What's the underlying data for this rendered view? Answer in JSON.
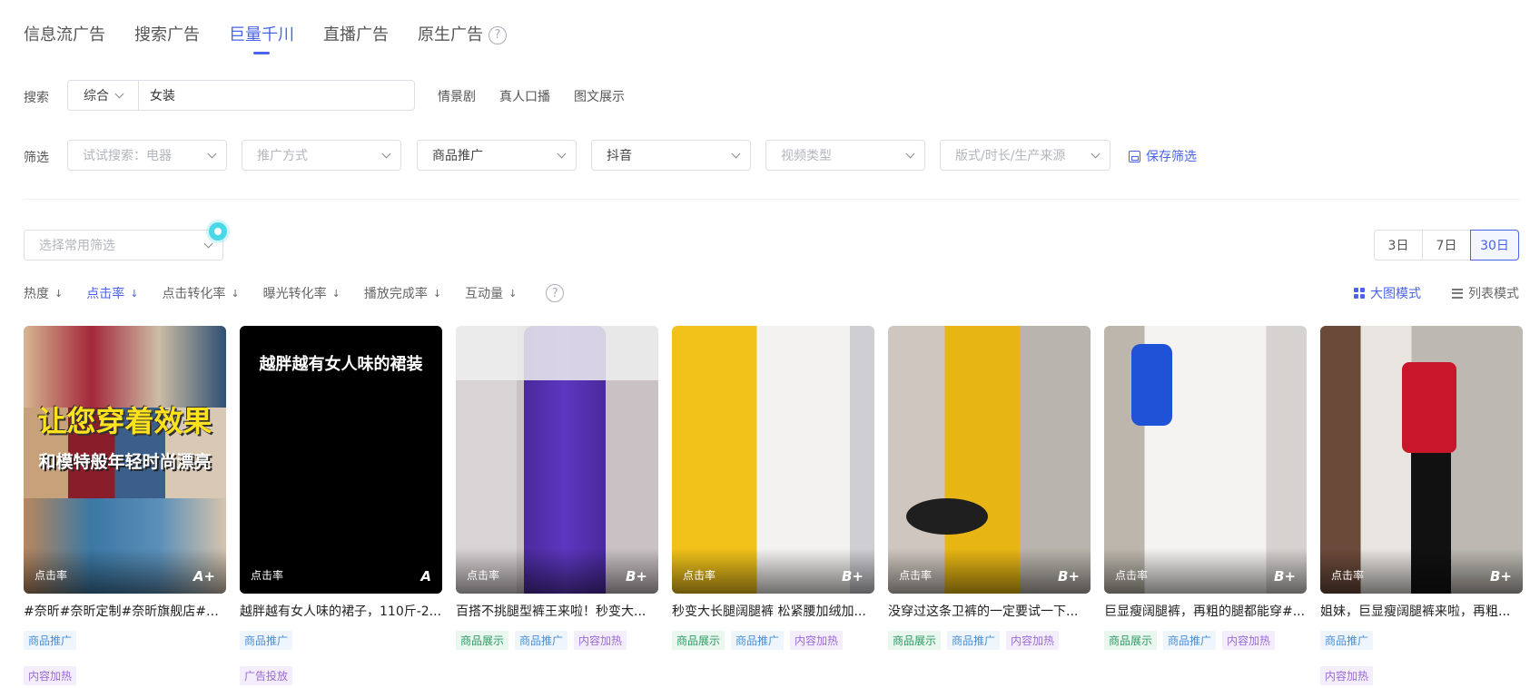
{
  "tabs": [
    {
      "label": "信息流广告",
      "active": false
    },
    {
      "label": "搜索广告",
      "active": false
    },
    {
      "label": "巨量千川",
      "active": true
    },
    {
      "label": "直播广告",
      "active": false
    },
    {
      "label": "原生广告",
      "active": false
    }
  ],
  "tab_help_icon": "question-circle-icon",
  "search": {
    "label": "搜索",
    "type_value": "综合",
    "query": "女装",
    "quick_tags": [
      "情景剧",
      "真人口播",
      "图文展示"
    ]
  },
  "filters": {
    "label": "筛选",
    "items": [
      {
        "placeholder": "试试搜索：电器",
        "value": ""
      },
      {
        "placeholder": "推广方式",
        "value": ""
      },
      {
        "placeholder": "",
        "value": "商品推广"
      },
      {
        "placeholder": "",
        "value": "抖音"
      },
      {
        "placeholder": "视频类型",
        "value": ""
      },
      {
        "placeholder": "版式/时长/生产来源",
        "value": ""
      }
    ],
    "save_label": "保存筛选"
  },
  "common_filter": {
    "placeholder": "选择常用筛选"
  },
  "date_range": {
    "options": [
      "3日",
      "7日",
      "30日"
    ],
    "selected": "30日"
  },
  "sorts": [
    {
      "label": "热度",
      "active": false
    },
    {
      "label": "点击率",
      "active": true
    },
    {
      "label": "点击转化率",
      "active": false
    },
    {
      "label": "曝光转化率",
      "active": false
    },
    {
      "label": "播放完成率",
      "active": false
    },
    {
      "label": "互动量",
      "active": false
    }
  ],
  "view_modes": {
    "grid": "大图模式",
    "list": "列表模式",
    "active": "grid"
  },
  "cards": [
    {
      "metric": "点击率",
      "grade": "A+",
      "title": "#奈昕#奈昕定制#奈昕旗舰店#真...",
      "overlay_main": "让您穿着效果",
      "overlay_sub": "和模特般年轻时尚漂亮",
      "tags": [
        [
          "商品推广",
          "blue"
        ],
        [
          "|",
          "break"
        ],
        [
          "内容加热",
          "purple"
        ]
      ]
    },
    {
      "metric": "点击率",
      "grade": "A",
      "title": "越胖越有女人味的裙子，110斤-2...",
      "overlay_title": "越胖越有女人味的裙装",
      "tags": [
        [
          "商品推广",
          "blue"
        ],
        [
          "|",
          "break"
        ],
        [
          "广告投放",
          "purple"
        ]
      ]
    },
    {
      "metric": "点击率",
      "grade": "B+",
      "title": "百搭不挑腿型裤王来啦！秒变大...",
      "tags": [
        [
          "商品展示",
          "green"
        ],
        [
          "商品推广",
          "blue"
        ],
        [
          "内容加热",
          "purple"
        ]
      ]
    },
    {
      "metric": "点击率",
      "grade": "B+",
      "title": "秒变大长腿阔腿裤 松紧腰加绒加...",
      "tags": [
        [
          "商品展示",
          "green"
        ],
        [
          "商品推广",
          "blue"
        ],
        [
          "内容加热",
          "purple"
        ]
      ]
    },
    {
      "metric": "点击率",
      "grade": "B+",
      "title": "没穿过这条卫裤的一定要试一下...",
      "tags": [
        [
          "商品展示",
          "green"
        ],
        [
          "商品推广",
          "blue"
        ],
        [
          "内容加热",
          "purple"
        ]
      ]
    },
    {
      "metric": "点击率",
      "grade": "B+",
      "title": "巨显瘦阔腿裤，再粗的腿都能穿#...",
      "tags": [
        [
          "商品展示",
          "green"
        ],
        [
          "商品推广",
          "blue"
        ],
        [
          "内容加热",
          "purple"
        ]
      ]
    },
    {
      "metric": "点击率",
      "grade": "B+",
      "title": "姐妹，巨显瘦阔腿裤来啦，再粗...",
      "tags": [
        [
          "商品推广",
          "blue"
        ],
        [
          "|",
          "break"
        ],
        [
          "内容加热",
          "purple"
        ]
      ]
    }
  ]
}
